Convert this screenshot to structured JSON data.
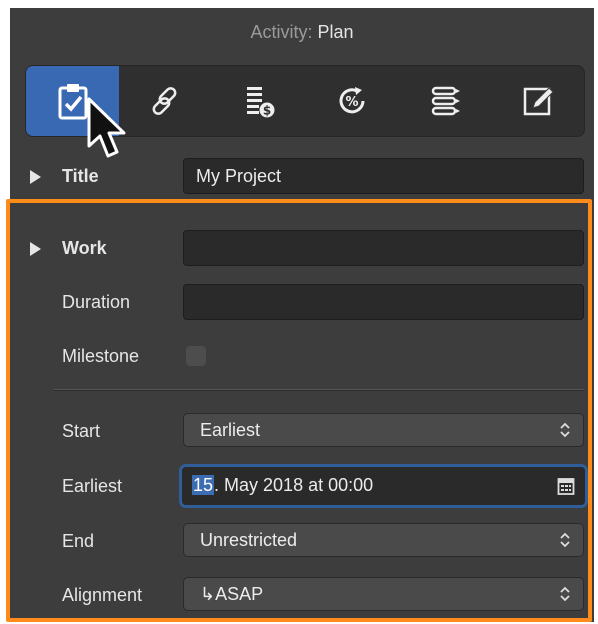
{
  "header": {
    "label": "Activity:",
    "value": "Plan"
  },
  "toolbar": {
    "tools": [
      {
        "icon": "clipboard-check-icon",
        "selected": true
      },
      {
        "icon": "link-icon",
        "selected": false
      },
      {
        "icon": "cost-list-icon",
        "selected": false
      },
      {
        "icon": "percent-progress-icon",
        "selected": false
      },
      {
        "icon": "list-icon",
        "selected": false
      },
      {
        "icon": "edit-icon",
        "selected": false
      }
    ]
  },
  "fields": {
    "title": {
      "label": "Title",
      "value": "My Project"
    },
    "work": {
      "label": "Work",
      "value": ""
    },
    "duration": {
      "label": "Duration",
      "value": ""
    },
    "milestone": {
      "label": "Milestone",
      "checked": false
    },
    "start": {
      "label": "Start",
      "value": "Earliest"
    },
    "earliest": {
      "label": "Earliest",
      "selected_part": "15",
      "rest": ". May 2018 at 00:00"
    },
    "end": {
      "label": "End",
      "value": "Unrestricted"
    },
    "alignment": {
      "label": "Alignment",
      "value": "↳ASAP"
    }
  },
  "colors": {
    "accent": "#3a69b3",
    "highlight_border": "#ff8c1a",
    "panel": "#3d3d3d"
  }
}
